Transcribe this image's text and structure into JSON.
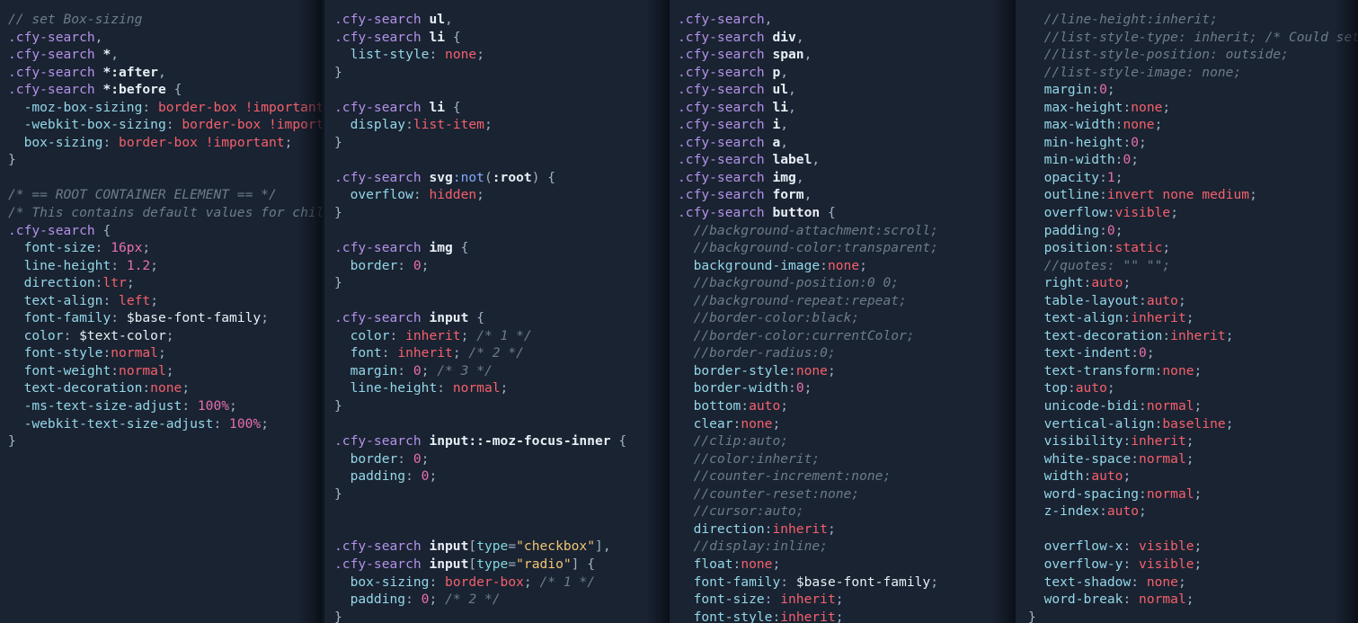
{
  "editor": {
    "kind": "code-viewer",
    "language": "scss",
    "theme": "dark-navy",
    "font_size_px": 14.6,
    "line_height_px": 19.55,
    "panel_count": 4,
    "colors": {
      "background": "#1a2332",
      "gutter_background": "#0d1520",
      "comment": "#6d7c8a",
      "selector_class": "#b392e8",
      "element_tag": "#e8eef5",
      "pseudo_class": "#82aaff",
      "attribute": "#80d8e0",
      "string": "#f0c674",
      "property": "#93d7e8",
      "value_keyword": "#f4606c",
      "number": "#e86fb0",
      "punctuation": "#9fb2c4"
    }
  },
  "panels": [
    {
      "id": "panel-1",
      "lines": [
        "// set Box-sizing",
        ".cfy-search,",
        ".cfy-search *,",
        ".cfy-search *:after,",
        ".cfy-search *:before {",
        "  -moz-box-sizing: border-box !important;",
        "  -webkit-box-sizing: border-box !important;",
        "  box-sizing: border-box !important;",
        "}",
        "",
        "/* == ROOT CONTAINER ELEMENT == */",
        "/* This contains default values for child ele",
        ".cfy-search {",
        "  font-size: 16px;",
        "  line-height: 1.2;",
        "  direction:ltr;",
        "  text-align: left;",
        "  font-family: $base-font-family;",
        "  color: $text-color;",
        "  font-style:normal;",
        "  font-weight:normal;",
        "  text-decoration:none;",
        "  -ms-text-size-adjust: 100%;",
        "  -webkit-text-size-adjust: 100%;",
        "}"
      ]
    },
    {
      "id": "panel-2",
      "lines": [
        ".cfy-search ul,",
        ".cfy-search li {",
        "  list-style: none;",
        "}",
        "",
        ".cfy-search li {",
        "  display:list-item;",
        "}",
        "",
        ".cfy-search svg:not(:root) {",
        "  overflow: hidden;",
        "}",
        "",
        ".cfy-search img {",
        "  border: 0;",
        "}",
        "",
        ".cfy-search input {",
        "  color: inherit; /* 1 */",
        "  font: inherit; /* 2 */",
        "  margin: 0; /* 3 */",
        "  line-height: normal;",
        "}",
        "",
        ".cfy-search input::-moz-focus-inner {",
        "  border: 0;",
        "  padding: 0;",
        "}",
        "",
        "",
        ".cfy-search input[type=\"checkbox\"],",
        ".cfy-search input[type=\"radio\"] {",
        "  box-sizing: border-box; /* 1 */",
        "  padding: 0; /* 2 */",
        "}"
      ]
    },
    {
      "id": "panel-3",
      "lines": [
        ".cfy-search,",
        ".cfy-search div,",
        ".cfy-search span,",
        ".cfy-search p,",
        ".cfy-search ul,",
        ".cfy-search li,",
        ".cfy-search i,",
        ".cfy-search a,",
        ".cfy-search label,",
        ".cfy-search img,",
        ".cfy-search form,",
        ".cfy-search button {",
        "  //background-attachment:scroll;",
        "  //background-color:transparent;",
        "  background-image:none;",
        "  //background-position:0 0;",
        "  //background-repeat:repeat;",
        "  //border-color:black;",
        "  //border-color:currentColor;",
        "  //border-radius:0;",
        "  border-style:none;",
        "  border-width:0;",
        "  bottom:auto;",
        "  clear:none;",
        "  //clip:auto;",
        "  //color:inherit;",
        "  //counter-increment:none;",
        "  //counter-reset:none;",
        "  //cursor:auto;",
        "  direction:inherit;",
        "  //display:inline;",
        "  float:none;",
        "  font-family: $base-font-family;",
        "  font-size: inherit;",
        "  font-style:inherit;"
      ]
    },
    {
      "id": "panel-4",
      "lines": [
        "  //line-height:inherit;",
        "  //list-style-type: inherit; /* Could set list-s",
        "  //list-style-position: outside;",
        "  //list-style-image: none;",
        "  margin:0;",
        "  max-height:none;",
        "  max-width:none;",
        "  min-height:0;",
        "  min-width:0;",
        "  opacity:1;",
        "  outline:invert none medium;",
        "  overflow:visible;",
        "  padding:0;",
        "  position:static;",
        "  //quotes: \"\" \"\";",
        "  right:auto;",
        "  table-layout:auto;",
        "  text-align:inherit;",
        "  text-decoration:inherit;",
        "  text-indent:0;",
        "  text-transform:none;",
        "  top:auto;",
        "  unicode-bidi:normal;",
        "  vertical-align:baseline;",
        "  visibility:inherit;",
        "  white-space:normal;",
        "  width:auto;",
        "  word-spacing:normal;",
        "  z-index:auto;",
        "",
        "  overflow-x: visible;",
        "  overflow-y: visible;",
        "  text-shadow: none;",
        "  word-break: normal;",
        "}"
      ]
    }
  ]
}
